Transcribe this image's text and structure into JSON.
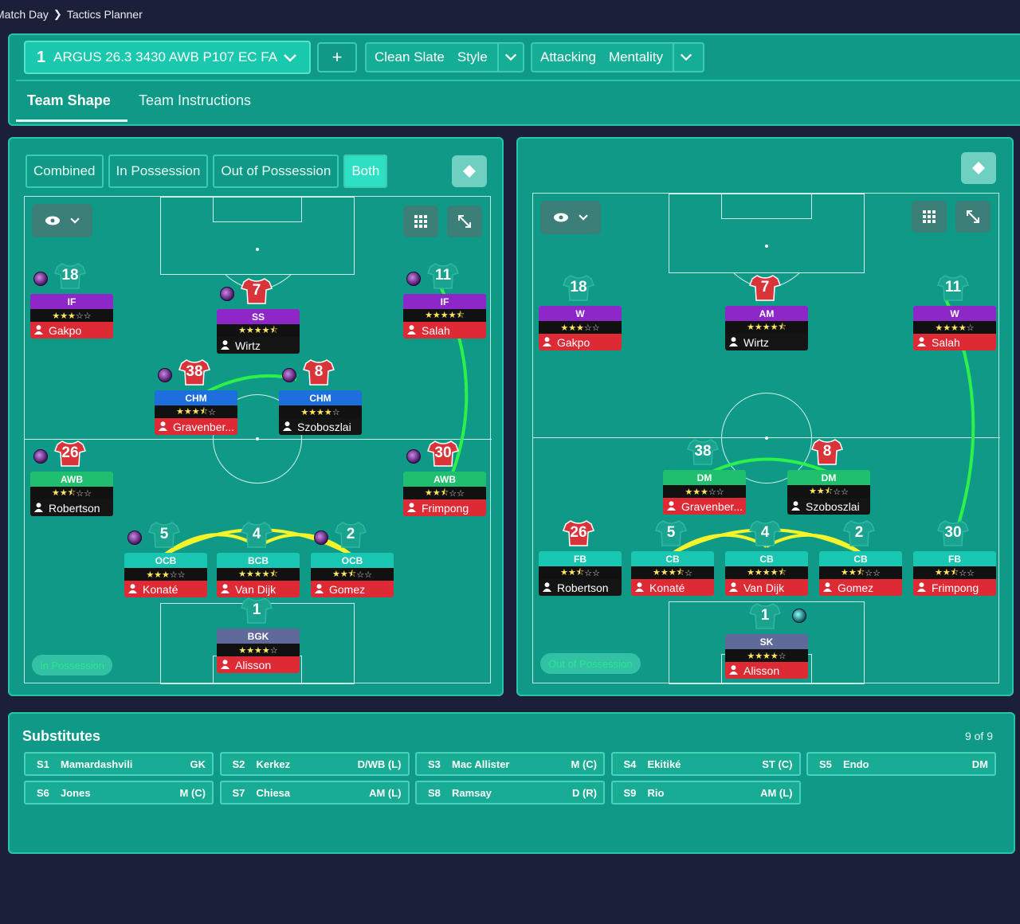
{
  "breadcrumb": {
    "parent": "Match Day",
    "current": "Tactics Planner"
  },
  "tactic": {
    "number": "1",
    "name": "ARGUS 26.3 3430 AWB P107 EC FA",
    "add_label": "+"
  },
  "style": {
    "value": "Clean Slate",
    "label": "Style"
  },
  "mentality": {
    "value": "Attacking",
    "label": "Mentality"
  },
  "tabs": [
    "Team Shape",
    "Team Instructions"
  ],
  "view_modes": [
    "Combined",
    "In Possession",
    "Out of Possession",
    "Both"
  ],
  "left_panel": {
    "phase": "In Possession",
    "players": [
      {
        "num": "18",
        "role": "IF",
        "stars": "★★★☆☆",
        "name": "Gakpo",
        "name_bg": "red"
      },
      {
        "num": "7",
        "role": "SS",
        "stars": "★★★★⯪",
        "name": "Wirtz",
        "name_bg": "black"
      },
      {
        "num": "11",
        "role": "IF",
        "stars": "★★★★⯪",
        "name": "Salah",
        "name_bg": "red"
      },
      {
        "num": "38",
        "role": "CHM",
        "stars": "★★★⯪☆",
        "name": "Gravenber...",
        "name_bg": "red"
      },
      {
        "num": "8",
        "role": "CHM",
        "stars": "★★★★☆",
        "name": "Szoboszlai",
        "name_bg": "black"
      },
      {
        "num": "26",
        "role": "AWB",
        "stars": "★★⯪☆☆",
        "name": "Robertson",
        "name_bg": "black"
      },
      {
        "num": "30",
        "role": "AWB",
        "stars": "★★⯪☆☆",
        "name": "Frimpong",
        "name_bg": "red"
      },
      {
        "num": "5",
        "role": "OCB",
        "stars": "★★★☆☆",
        "name": "Konaté",
        "name_bg": "red"
      },
      {
        "num": "4",
        "role": "BCB",
        "stars": "★★★★⯪",
        "name": "Van Dijk",
        "name_bg": "red"
      },
      {
        "num": "2",
        "role": "OCB",
        "stars": "★★⯪☆☆",
        "name": "Gomez",
        "name_bg": "red"
      },
      {
        "num": "1",
        "role": "BGK",
        "stars": "★★★★☆",
        "name": "Alisson",
        "name_bg": "red"
      }
    ]
  },
  "right_panel": {
    "phase": "Out of Possession",
    "players": [
      {
        "num": "18",
        "role": "W",
        "stars": "★★★☆☆",
        "name": "Gakpo",
        "name_bg": "red"
      },
      {
        "num": "7",
        "role": "AM",
        "stars": "★★★★⯪",
        "name": "Wirtz",
        "name_bg": "black"
      },
      {
        "num": "11",
        "role": "W",
        "stars": "★★★★☆",
        "name": "Salah",
        "name_bg": "red"
      },
      {
        "num": "38",
        "role": "DM",
        "stars": "★★★☆☆",
        "name": "Gravenber...",
        "name_bg": "red"
      },
      {
        "num": "8",
        "role": "DM",
        "stars": "★★⯪☆☆",
        "name": "Szoboszlai",
        "name_bg": "black"
      },
      {
        "num": "26",
        "role": "FB",
        "stars": "★★⯪☆☆",
        "name": "Robertson",
        "name_bg": "black"
      },
      {
        "num": "5",
        "role": "CB",
        "stars": "★★★⯪☆",
        "name": "Konaté",
        "name_bg": "red"
      },
      {
        "num": "4",
        "role": "CB",
        "stars": "★★★★⯪",
        "name": "Van Dijk",
        "name_bg": "red"
      },
      {
        "num": "2",
        "role": "CB",
        "stars": "★★⯪☆☆",
        "name": "Gomez",
        "name_bg": "red"
      },
      {
        "num": "30",
        "role": "FB",
        "stars": "★★⯪☆☆",
        "name": "Frimpong",
        "name_bg": "red"
      },
      {
        "num": "1",
        "role": "SK",
        "stars": "★★★★☆",
        "name": "Alisson",
        "name_bg": "red"
      }
    ]
  },
  "substitutes": {
    "title": "Substitutes",
    "count": "9 of 9",
    "items": [
      {
        "id": "S1",
        "name": "Mamardashvili",
        "pos": "GK"
      },
      {
        "id": "S2",
        "name": "Kerkez",
        "pos": "D/WB (L)"
      },
      {
        "id": "S3",
        "name": "Mac Allister",
        "pos": "M (C)"
      },
      {
        "id": "S4",
        "name": "Ekitiké",
        "pos": "ST (C)"
      },
      {
        "id": "S5",
        "name": "Endo",
        "pos": "DM"
      },
      {
        "id": "S6",
        "name": "Jones",
        "pos": "M (C)"
      },
      {
        "id": "S7",
        "name": "Chiesa",
        "pos": "AM (L)"
      },
      {
        "id": "S8",
        "name": "Ramsay",
        "pos": "D (R)"
      },
      {
        "id": "S9",
        "name": "Rio",
        "pos": "AM (L)"
      }
    ]
  },
  "colors": {
    "panel": "#0e9a86",
    "accent": "#19c9ad",
    "link_green": "#2df04a",
    "link_yellow": "#f4f42a"
  }
}
